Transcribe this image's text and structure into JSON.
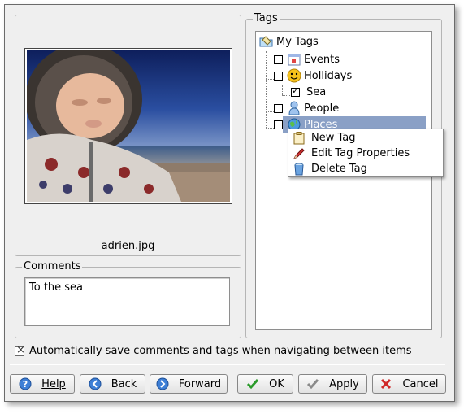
{
  "image": {
    "filename": "adrien.jpg"
  },
  "comments": {
    "title": "Comments",
    "value": "To the sea"
  },
  "tags": {
    "title": "Tags",
    "root": "My Tags",
    "items": [
      {
        "label": "Events",
        "checked": false,
        "icon": "calendar-icon"
      },
      {
        "label": "Hollidays",
        "checked": false,
        "icon": "smiley-icon"
      },
      {
        "label": "Sea",
        "checked": true,
        "icon": ""
      },
      {
        "label": "People",
        "checked": false,
        "icon": "person-icon"
      },
      {
        "label": "Places",
        "checked": false,
        "icon": "globe-icon"
      }
    ]
  },
  "context_menu": {
    "items": [
      {
        "label": "New Tag",
        "icon": "clipboard-icon"
      },
      {
        "label": "Edit Tag Properties",
        "icon": "pencil-icon"
      },
      {
        "label": "Delete Tag",
        "icon": "trash-icon"
      }
    ]
  },
  "auto_save": {
    "label": "Automatically save comments and tags when navigating between items",
    "checked": true
  },
  "buttons": {
    "help": "Help",
    "back": "Back",
    "forward": "Forward",
    "ok": "OK",
    "apply": "Apply",
    "cancel": "Cancel"
  },
  "colors": {
    "selection": "#8aa0c6",
    "window_bg": "#efefef"
  }
}
